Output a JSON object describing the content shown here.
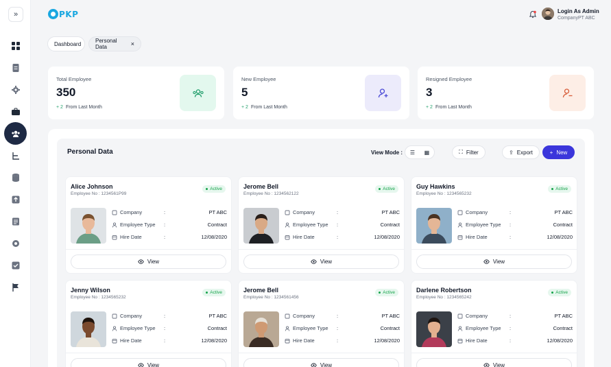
{
  "app": {
    "logo_text": "PKP"
  },
  "header": {
    "user_name": "Login As Admin",
    "user_company": "CompanyPT ABC"
  },
  "breadcrumb": {
    "home": "Dashboard",
    "current": "Personal Data",
    "close": "×"
  },
  "stats": [
    {
      "label": "Total Employee",
      "value": "350",
      "delta": "+ 2",
      "period": "From Last Month",
      "icon": "users-icon",
      "bg": "#e3f8ee",
      "fg": "#1f9d6a"
    },
    {
      "label": "New Employee",
      "value": "5",
      "delta": "+ 2",
      "period": "From Last Month",
      "icon": "user-plus-icon",
      "bg": "#ecebfb",
      "fg": "#4b4ad6"
    },
    {
      "label": "Resigned Employee",
      "value": "3",
      "delta": "+ 2",
      "period": "From Last Month",
      "icon": "user-minus-icon",
      "bg": "#fdeee6",
      "fg": "#d85d3a"
    }
  ],
  "panel": {
    "title": "Personal Data",
    "view_mode_label": "View Mode :",
    "filter_label": "Filter",
    "export_label": "Export",
    "new_label": "New"
  },
  "labels": {
    "company": "Company",
    "type": "Employee Type",
    "hire": "Hire Date",
    "colon": ":",
    "view": "View"
  },
  "employees": [
    {
      "name": "Alice Johnson",
      "emp_no": "Employee No : 1234561P99",
      "status": "Active",
      "company": "PT ABC",
      "type": "Contract",
      "hire": "12/08/2020"
    },
    {
      "name": "Jerome Bell",
      "emp_no": "Employee No : 1234562122",
      "status": "Active",
      "company": "PT ABC",
      "type": "Contract",
      "hire": "12/08/2020"
    },
    {
      "name": "Guy Hawkins",
      "emp_no": "Employee No : 1234565232",
      "status": "Active",
      "company": "PT ABC",
      "type": "Contract",
      "hire": "12/08/2020"
    },
    {
      "name": "Jenny Wilson",
      "emp_no": "Employee No : 1234565232",
      "status": "Active",
      "company": "PT ABC",
      "type": "Contract",
      "hire": "12/08/2020"
    },
    {
      "name": "Jerome Bell",
      "emp_no": "Employee No : 1234561456",
      "status": "Active",
      "company": "PT ABC",
      "type": "Contract",
      "hire": "12/08/2020"
    },
    {
      "name": "Darlene Robertson",
      "emp_no": "Employee No : 1234565242",
      "status": "Active",
      "company": "PT ABC",
      "type": "Contract",
      "hire": "12/08/2020"
    }
  ],
  "colors": {
    "accent": "#3b36db",
    "sidebar_active": "#1e2a44",
    "active_green": "#16a34a",
    "logo": "#1aa7e0"
  }
}
